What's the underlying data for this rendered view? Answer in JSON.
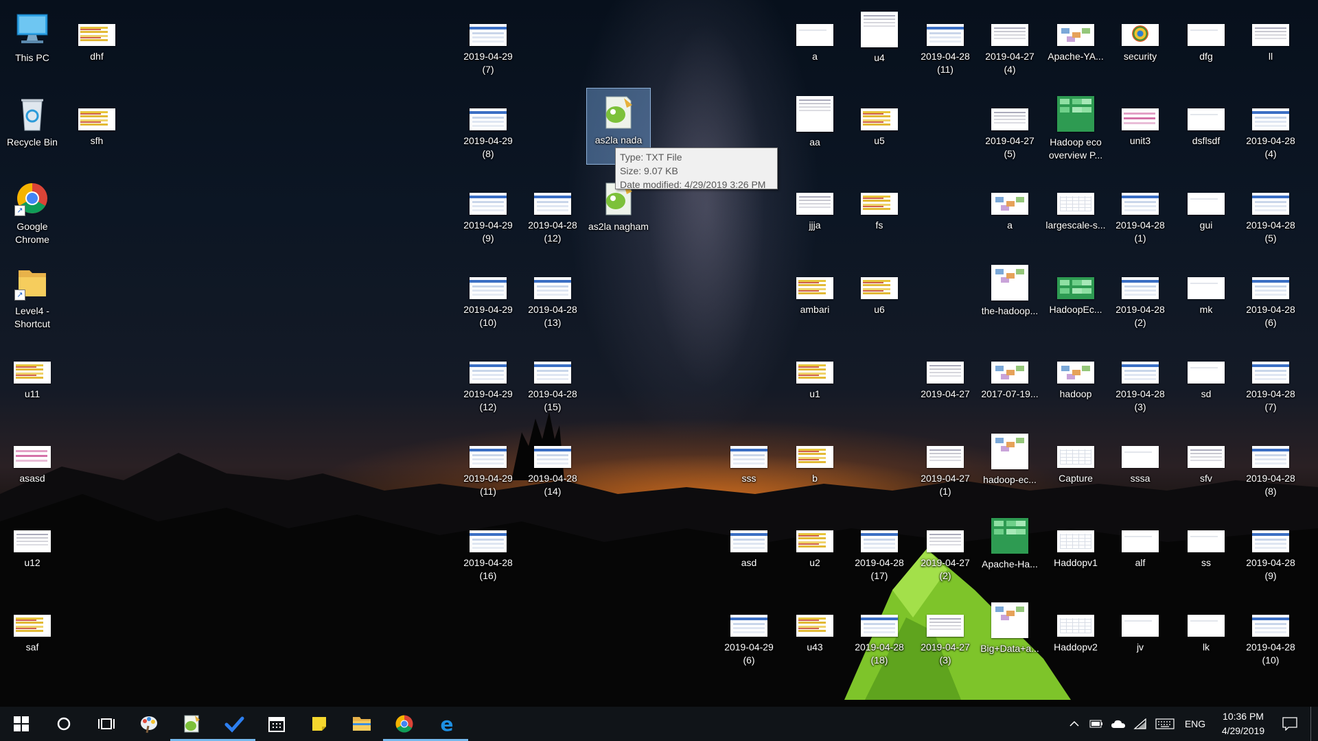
{
  "desktop_icons": {
    "this_pc": "This PC",
    "dhf": "dhf",
    "recycle_bin": "Recycle Bin",
    "sfh": "sfh",
    "google_chrome": "Google Chrome",
    "level4_shortcut": "Level4 - Shortcut",
    "u11": "u11",
    "asasd": "asasd",
    "u12": "u12",
    "saf": "saf",
    "c7_r1": "2019-04-29 (7)",
    "c7_r2": "2019-04-29 (8)",
    "c7_r3": "2019-04-29 (9)",
    "c7_r4": "2019-04-29 (10)",
    "c7_r5": "2019-04-29 (12)",
    "c7_r6": "2019-04-29 (11)",
    "c7_r7": "2019-04-28 (16)",
    "c8_r3": "2019-04-28 (12)",
    "c8_r4": "2019-04-28 (13)",
    "c8_r5": "2019-04-28 (15)",
    "c8_r6": "2019-04-28 (14)",
    "as2la_nada": "as2la nada",
    "as2la_nagham": "as2la nagham",
    "sss": "sss",
    "asd": "asd",
    "c11_r8": "2019-04-29 (6)",
    "a1": "a",
    "aa": "aa",
    "jjja": "jjja",
    "ambari": "ambari",
    "u1": "u1",
    "b": "b",
    "u2": "u2",
    "u43": "u43",
    "u4": "u4",
    "u5": "u5",
    "fs": "fs",
    "u6": "u6",
    "c13_r7": "2019-04-28 (17)",
    "c13_r8": "2019-04-28 (18)",
    "c14_r1": "2019-04-28 (11)",
    "c14_r5": "2019-04-27",
    "c14_r6": "2019-04-27 (1)",
    "c14_r7": "2019-04-27 (2)",
    "c14_r8": "2019-04-27 (3)",
    "c15_r1": "2019-04-27 (4)",
    "c15_r2": "2019-04-27 (5)",
    "a2": "a",
    "the_hadoop": "the-hadoop...",
    "c15_r5": "2017-07-19...",
    "hadoop_ec": "hadoop-ec...",
    "apache_ha": "Apache-Ha...",
    "big_data": "Big+Data+a...",
    "apache_ya": "Apache-YA...",
    "hadoop_eco": "Hadoop eco overview P...",
    "largescale": "largescale-s...",
    "hadoopec": "HadoopEc...",
    "hadoop": "hadoop",
    "capture": "Capture",
    "haddopv1": "Haddopv1",
    "haddopv2": "Haddopv2",
    "security": "security",
    "unit3": "unit3",
    "c17_r3": "2019-04-28 (1)",
    "c17_r4": "2019-04-28 (2)",
    "c17_r5": "2019-04-28 (3)",
    "sssa": "sssa",
    "alf": "alf",
    "jv": "jv",
    "dfg": "dfg",
    "dsflsdf": "dsflsdf",
    "gui": "gui",
    "mk": "mk",
    "sd": "sd",
    "sfv": "sfv",
    "ss": "ss",
    "lk": "lk",
    "ll": "ll",
    "c19_r2": "2019-04-28 (4)",
    "c19_r3": "2019-04-28 (5)",
    "c19_r4": "2019-04-28 (6)",
    "c19_r5": "2019-04-28 (7)",
    "c19_r6": "2019-04-28 (8)",
    "c19_r7": "2019-04-28 (9)",
    "c19_r8": "2019-04-28 (10)"
  },
  "tooltip": {
    "type": "Type: TXT File",
    "size": "Size: 9.07 KB",
    "modified": "Date modified: 4/29/2019 3:26 PM"
  },
  "taskbar": {
    "pinned": [
      "start",
      "cortana-search",
      "task-view",
      "paint",
      "notepad-plus-plus",
      "todo",
      "calendar",
      "sticky-notes",
      "file-explorer",
      "google-chrome",
      "microsoft-edge"
    ],
    "active": [
      "notepad-plus-plus",
      "todo",
      "google-chrome",
      "microsoft-edge"
    ],
    "language": "ENG",
    "time": "10:36 PM",
    "date": "4/29/2019",
    "accent": "#76b9ed"
  }
}
